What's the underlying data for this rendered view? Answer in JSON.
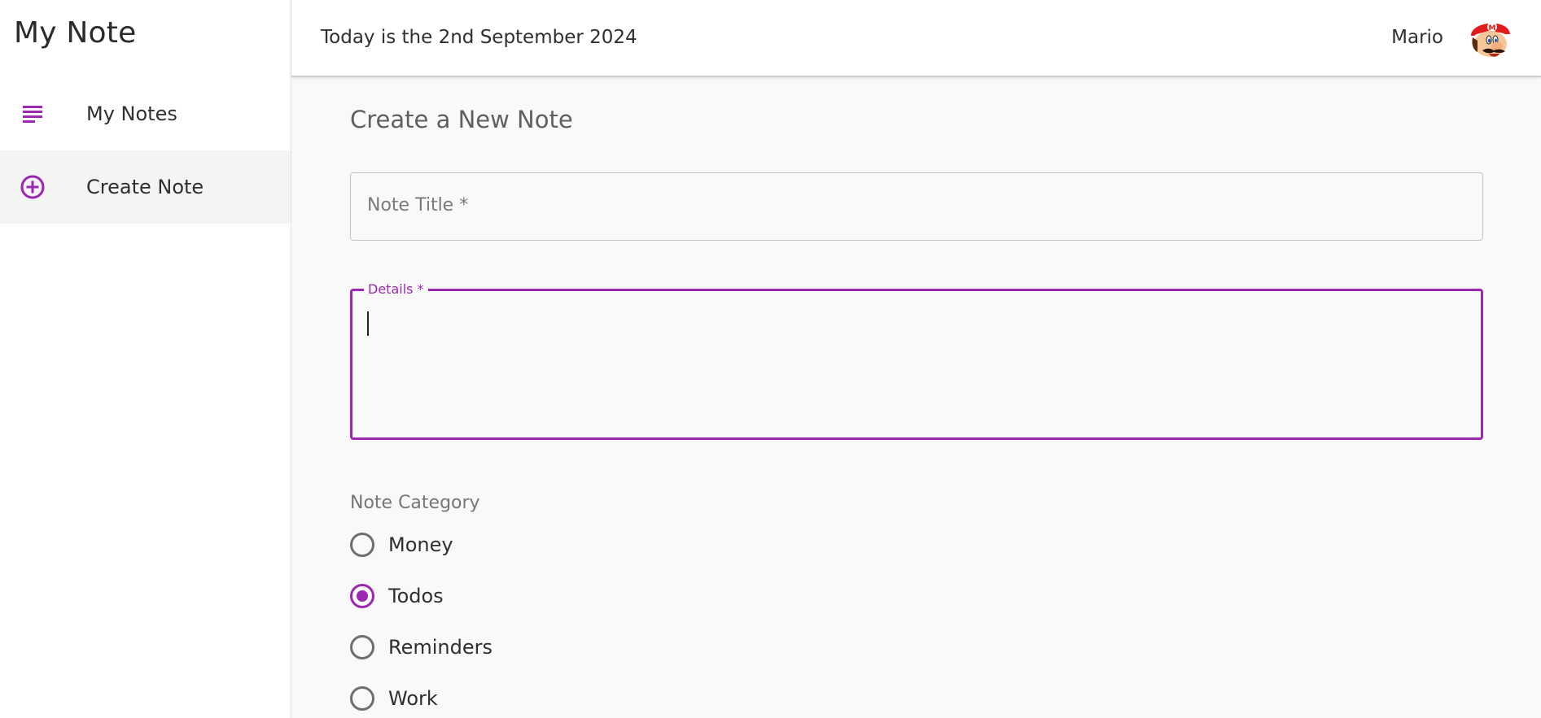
{
  "app": {
    "title": "My Note"
  },
  "sidebar": {
    "items": [
      {
        "label": "My Notes",
        "icon": "subject-lines-icon",
        "active": false
      },
      {
        "label": "Create Note",
        "icon": "add-circle-icon",
        "active": true
      }
    ]
  },
  "header": {
    "date_text": "Today is the 2nd September 2024",
    "username": "Mario",
    "avatar_icon": "mario-avatar"
  },
  "form": {
    "page_title": "Create a New Note",
    "title_field": {
      "placeholder": "Note Title *",
      "value": ""
    },
    "details_field": {
      "label": "Details *",
      "value": "",
      "focused": true
    },
    "category": {
      "label": "Note Category",
      "options": [
        "Money",
        "Todos",
        "Reminders",
        "Work"
      ],
      "selected": "Todos"
    }
  },
  "colors": {
    "accent": "#9c27b0",
    "background": "#f9f9f9",
    "sidebar_active": "#f4f4f4"
  }
}
